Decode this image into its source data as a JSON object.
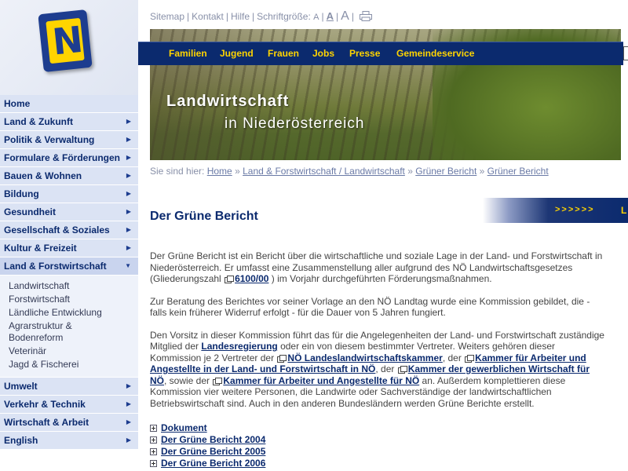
{
  "logo": {
    "letter": "N"
  },
  "nav": {
    "items": [
      {
        "label": "Home",
        "arrow": ""
      },
      {
        "label": "Land & Zukunft",
        "arrow": "▶"
      },
      {
        "label": "Politik & Verwaltung",
        "arrow": "▶"
      },
      {
        "label": "Formulare & Förderungen",
        "arrow": "▶"
      },
      {
        "label": "Bauen & Wohnen",
        "arrow": "▶"
      },
      {
        "label": "Bildung",
        "arrow": "▶"
      },
      {
        "label": "Gesundheit",
        "arrow": "▶"
      },
      {
        "label": "Gesellschaft & Soziales",
        "arrow": "▶"
      },
      {
        "label": "Kultur & Freizeit",
        "arrow": "▶"
      },
      {
        "label": "Land & Forstwirtschaft",
        "arrow": "▼"
      },
      {
        "label": "Umwelt",
        "arrow": "▶"
      },
      {
        "label": "Verkehr & Technik",
        "arrow": "▶"
      },
      {
        "label": "Wirtschaft & Arbeit",
        "arrow": "▶"
      },
      {
        "label": "English",
        "arrow": "▶"
      }
    ],
    "subitems": [
      "Landwirtschaft",
      "Forstwirtschaft",
      "Ländliche Entwicklung",
      "Agrarstruktur &",
      "Bodenreform",
      "Veterinär",
      "Jagd & Fischerei"
    ]
  },
  "toplinks": {
    "sitemap": "Sitemap",
    "kontakt": "Kontakt",
    "hilfe": "Hilfe",
    "fontsize_label": "Schriftgröße:",
    "a_small": "A",
    "a_medium": "A",
    "a_large": "A",
    "sep": "|"
  },
  "tabs": [
    "Familien",
    "Jugend",
    "Frauen",
    "Jobs",
    "Presse",
    "Gemeindeservice"
  ],
  "banner": {
    "title": "Landwirtschaft",
    "subtitle": "in Niederösterreich"
  },
  "breadcrumb": {
    "prefix": "Sie sind hier:",
    "items": [
      "Home",
      "Land & Forstwirtschaft / Landwirtschaft",
      "Grüner Bericht",
      "Grüner Bericht"
    ],
    "sep": "»"
  },
  "rightbox": {
    "arrows": ">>>>>>",
    "letter": "L"
  },
  "page_title": "Der Grüne Bericht",
  "content": {
    "p1_a": "Der Grüne Bericht ist ein Bericht über die wirtschaftliche und soziale Lage in der Land- und Forstwirtschaft in Niederösterreich. Er umfasst eine Zusammenstellung aller aufgrund des NÖ Landwirtschaftsgesetzes (Gliederungszahl",
    "p1_link": "6100/00",
    "p1_b": ") im Vorjahr durchgeführten Förderungsmaßnahmen.",
    "p2": "Zur Beratung des Berichtes vor seiner Vorlage an den NÖ Landtag wurde eine Kommission gebildet, die - falls kein früherer Widerruf erfolgt - für die Dauer von 5 Jahren fungiert.",
    "p3_a": "Den Vorsitz in dieser Kommission führt das für die Angelegenheiten der Land- und Forstwirtschaft zuständige Mitglied der",
    "p3_link1": "Landesregierung",
    "p3_b": "oder ein von diesem bestimmter Vertreter. Weiters gehören dieser Kommission je 2 Vertreter der",
    "p3_link2": "NÖ Landeslandwirtschaftskammer",
    "p3_c": ", der",
    "p3_link3": "Kammer für Arbeiter und Angestellte in der Land- und Forstwirtschaft in NÖ",
    "p3_d": ", der",
    "p3_link4": "Kammer der gewerblichen Wirtschaft für NÖ",
    "p3_e": ", sowie der",
    "p3_link5": "Kammer für Arbeiter und Angestellte für NÖ",
    "p3_f": "an. Außerdem komplettieren diese Kommission vier weitere Personen, die Landwirte oder Sachverständige der landwirtschaftlichen Betriebswirtschaft sind. Auch in den anderen Bundesländern werden Grüne Berichte erstellt."
  },
  "links": [
    "Dokument",
    "Der Grüne Bericht 2004",
    "Der Grüne Bericht 2005",
    "Der Grüne Bericht 2006"
  ]
}
